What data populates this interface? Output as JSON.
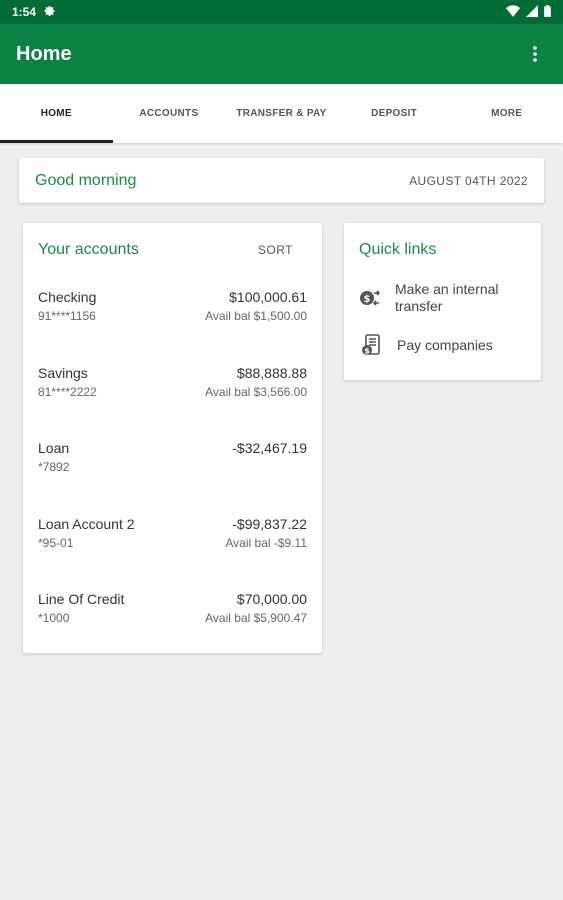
{
  "status": {
    "time": "1:54"
  },
  "appbar": {
    "title": "Home"
  },
  "tabs": [
    {
      "label": "HOME",
      "active": true
    },
    {
      "label": "ACCOUNTS"
    },
    {
      "label": "TRANSFER & PAY"
    },
    {
      "label": "DEPOSIT"
    },
    {
      "label": "MORE"
    }
  ],
  "greeting": {
    "text": "Good morning",
    "date": "AUGUST 04TH 2022"
  },
  "accounts": {
    "title": "Your accounts",
    "sort_label": "SORT",
    "items": [
      {
        "name": "Checking",
        "number": "91****1156",
        "balance": "$100,000.61",
        "avail": "Avail bal $1,500.00"
      },
      {
        "name": "Savings",
        "number": "81****2222",
        "balance": "$88,888.88",
        "avail": "Avail bal $3,566.00"
      },
      {
        "name": "Loan",
        "number": "*7892",
        "balance": "-$32,467.19",
        "avail": ""
      },
      {
        "name": "Loan Account 2",
        "number": "*95-01",
        "balance": "-$99,837.22",
        "avail": "Avail bal -$9.11"
      },
      {
        "name": "Line Of Credit",
        "number": "*1000",
        "balance": "$70,000.00",
        "avail": "Avail bal $5,900.47"
      }
    ]
  },
  "quick_links": {
    "title": "Quick links",
    "items": [
      {
        "label": "Make an internal transfer",
        "icon": "transfer-icon"
      },
      {
        "label": "Pay companies",
        "icon": "pay-companies-icon"
      }
    ]
  },
  "colors": {
    "status_bar": "#006b33",
    "app_bar": "#0a8244",
    "accent_text": "#1a8a4a",
    "background": "#eeeeee"
  }
}
